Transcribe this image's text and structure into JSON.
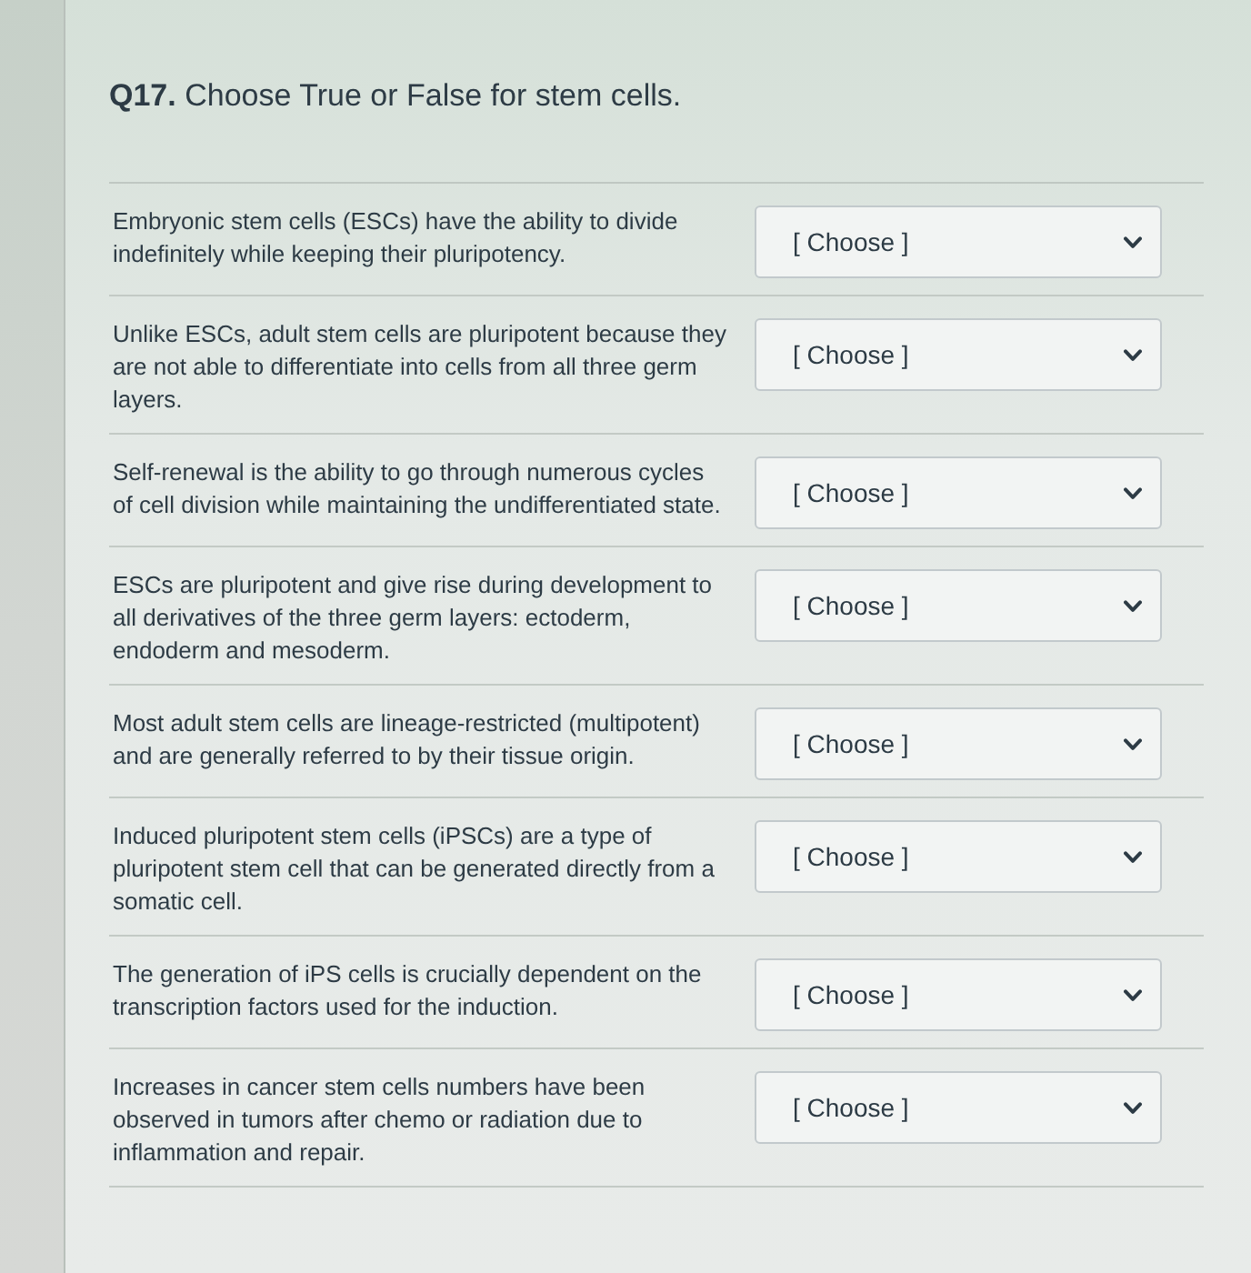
{
  "question": {
    "title": "**Q17.** Choose True or False for stem cells."
  },
  "items": [
    {
      "statement": "Embryonic stem cells (ESCs) have the ability to divide indefinitely while keeping their pluripotency.",
      "dropdown": {
        "value": "[ Choose ]"
      }
    },
    {
      "statement": "Unlike ESCs, adult stem cells are pluripotent because they are not able to differentiate into cells from all three germ layers.",
      "dropdown": {
        "value": "[ Choose ]"
      }
    },
    {
      "statement": "Self-renewal is the ability to go through numerous cycles of cell division while maintaining the undifferentiated state.",
      "dropdown": {
        "value": "[ Choose ]"
      }
    },
    {
      "statement": "ESCs are pluripotent and give rise during development to all derivatives of the three germ layers: ectoderm, endoderm and mesoderm.",
      "dropdown": {
        "value": "[ Choose ]"
      }
    },
    {
      "statement": "Most adult stem cells are lineage-restricted (multipotent) and are generally referred to by their tissue origin.",
      "dropdown": {
        "value": "[ Choose ]"
      }
    },
    {
      "statement": "Induced pluripotent stem cells (iPSCs) are a type of pluripotent stem cell that can be generated directly from a somatic cell.",
      "dropdown": {
        "value": "[ Choose ]"
      }
    },
    {
      "statement": "The generation of iPS cells is crucially dependent on the transcription factors used for the induction.",
      "dropdown": {
        "value": "[ Choose ]"
      }
    },
    {
      "statement": "Increases in cancer stem cells numbers have been observed in tumors after chemo or radiation due to inflammation and repair.",
      "dropdown": {
        "value": "[ Choose ]"
      }
    }
  ]
}
